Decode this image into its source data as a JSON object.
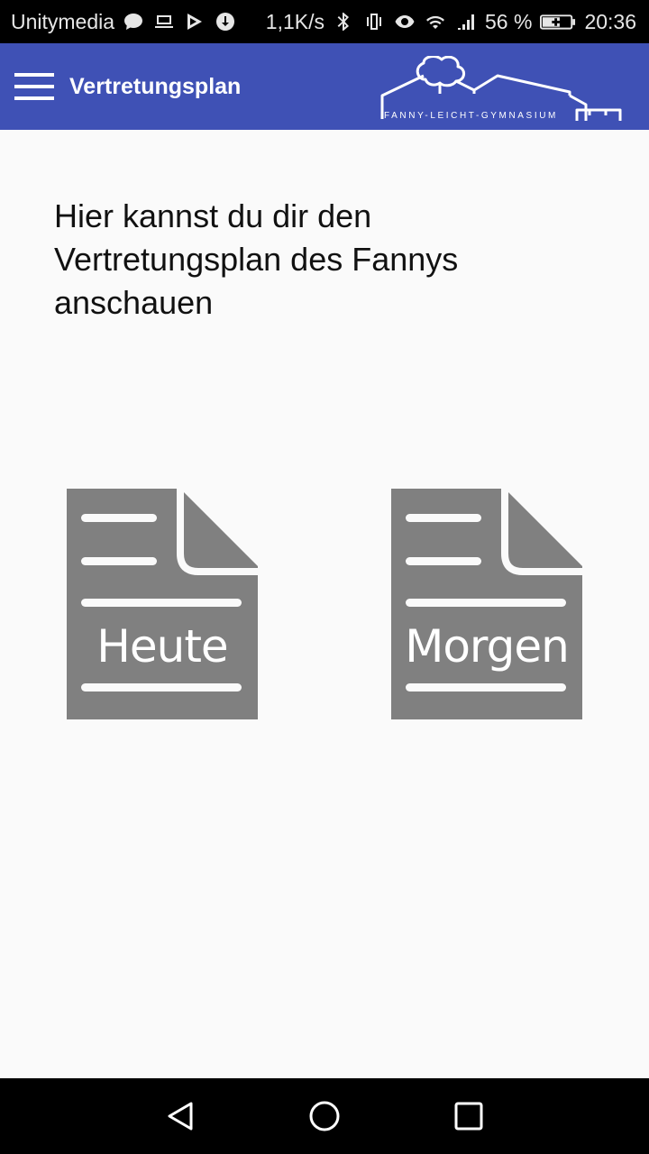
{
  "status_bar": {
    "carrier": "Unitymedia",
    "speed": "1,1K/s",
    "battery": "56 %",
    "time": "20:36",
    "icons": [
      "chat-bubble-icon",
      "laptop-icon",
      "play-store-icon",
      "download-icon",
      "bluetooth-icon",
      "vibrate-icon",
      "eye-icon",
      "wifi-icon",
      "signal-icon",
      "battery-charging-icon"
    ]
  },
  "app_bar": {
    "title": "Vertretungsplan",
    "logo_text": "FANNY-LEICHT-GYMNASIUM",
    "color": "#3f51b5"
  },
  "content": {
    "intro": "Hier kannst du dir den Vertretungsplan des Fannys anschauen",
    "buttons": [
      {
        "label": "Heute"
      },
      {
        "label": "Morgen"
      }
    ]
  },
  "nav_bar": {
    "icons": [
      "back-icon",
      "home-icon",
      "recents-icon"
    ]
  }
}
